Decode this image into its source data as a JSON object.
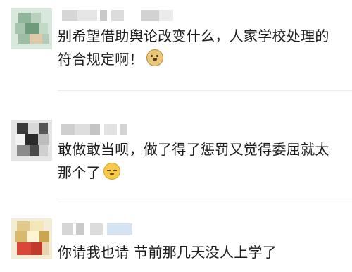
{
  "comments": [
    {
      "text": "别希望借助舆论改变什么，人家学校处理的符合规定啊！",
      "emoji": "doge-emoji"
    },
    {
      "text": "敢做敢当呗，做了得了惩罚又觉得委屈就太那个了",
      "emoji": "sleepy-emoji"
    },
    {
      "text": "你请我也请 节前那几天没人上学了",
      "emoji": ""
    }
  ]
}
